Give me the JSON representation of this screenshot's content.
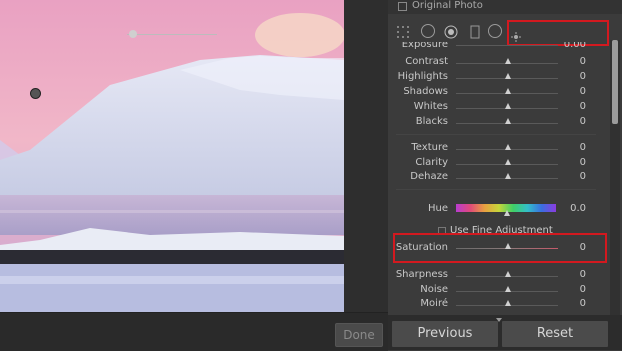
{
  "panel": {
    "header_title": "Original Photo",
    "rows": [
      {
        "label": "Exposure",
        "value": "0.00"
      },
      {
        "label": "Contrast",
        "value": "0"
      },
      {
        "label": "Highlights",
        "value": "0"
      },
      {
        "label": "Shadows",
        "value": "0"
      },
      {
        "label": "Whites",
        "value": "0"
      },
      {
        "label": "Blacks",
        "value": "0"
      },
      {
        "label": "Texture",
        "value": "0"
      },
      {
        "label": "Clarity",
        "value": "0"
      },
      {
        "label": "Dehaze",
        "value": "0"
      },
      {
        "label": "Hue",
        "value": "0.0"
      },
      {
        "label": "Saturation",
        "value": "0"
      },
      {
        "label": "Sharpness",
        "value": "0"
      },
      {
        "label": "Noise",
        "value": "0"
      },
      {
        "label": "Moiré",
        "value": "0"
      }
    ],
    "fine_adjustment_label": "Use Fine Adjustment"
  },
  "buttons": {
    "done": "Done",
    "previous": "Previous",
    "reset": "Reset"
  },
  "colors": {
    "highlight_box": "#d3191f",
    "panel_bg": "#3b3b3b"
  },
  "icons": [
    "grid-dots-icon",
    "circle-arrow-icon",
    "radial-dot-icon",
    "rectangle-icon",
    "circle-icon",
    "sun-icon"
  ]
}
